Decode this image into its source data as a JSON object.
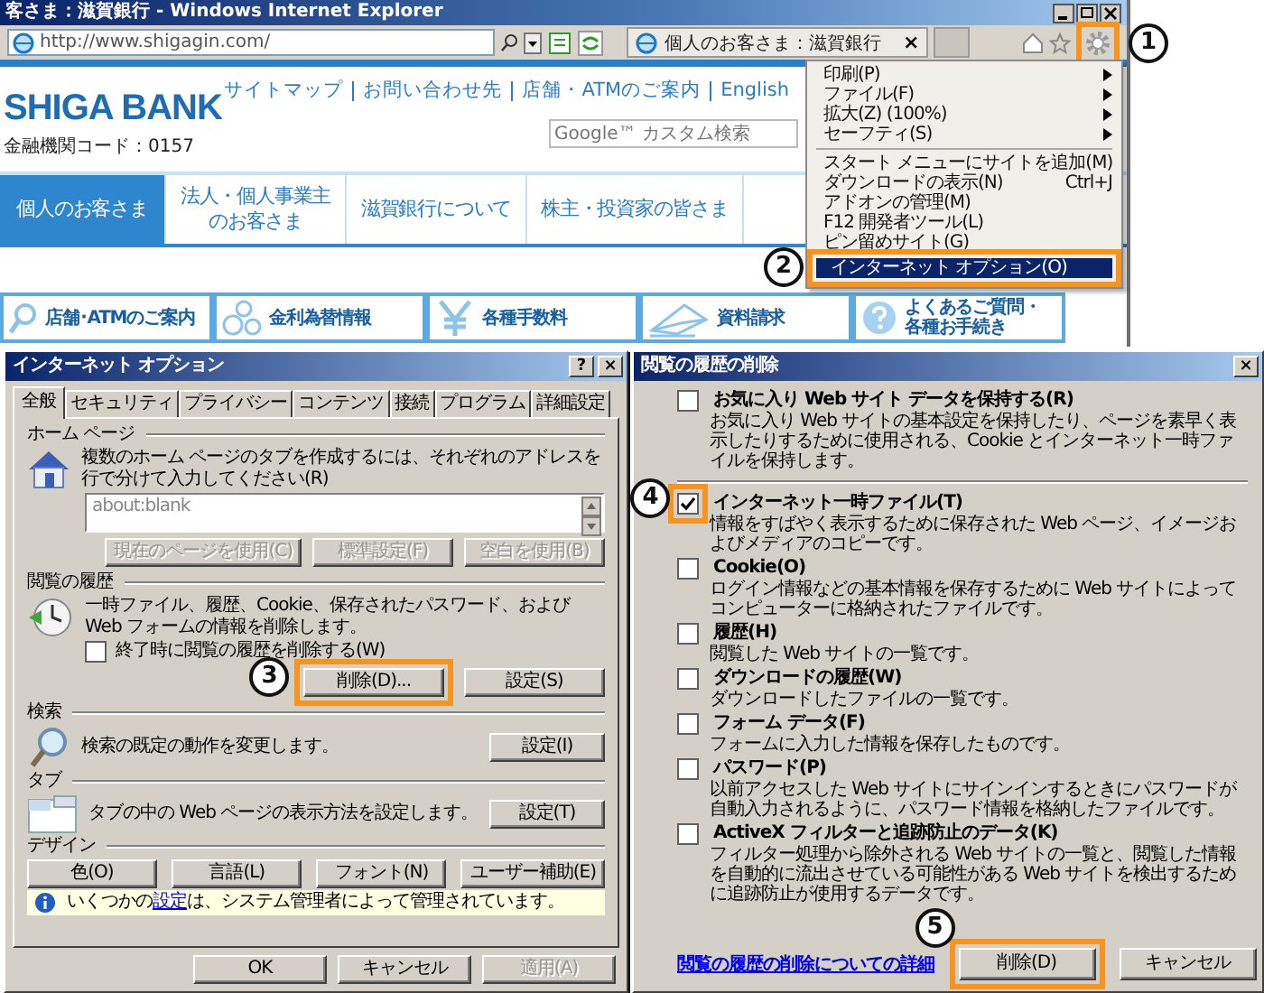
{
  "browser": {
    "title": "客さま：滋賀銀行 - Windows Internet Explorer",
    "address": "http://www.shigagin.com/",
    "tab": {
      "title": "個人のお客さま：滋賀銀行",
      "close": "×"
    },
    "settings": {
      "highlighted": true,
      "callout": "1"
    }
  },
  "page": {
    "logo": "SHIGA BANK",
    "bank_code": "金融機関コード：0157",
    "top_links": [
      "サイトマップ",
      "お問い合わせ先",
      "店舗・ATMのご案内",
      "English"
    ],
    "search_placeholder": "Google™ カスタム検索",
    "nav": [
      {
        "label": "個人のお客さま",
        "selected": true
      },
      {
        "label": "法人・個人事業主のお客さま",
        "selected": false
      },
      {
        "label": "滋賀銀行について",
        "selected": false
      },
      {
        "label": "株主・投資家の皆さま",
        "selected": false
      }
    ],
    "quick_links": [
      {
        "label": "店舗･ATMのご案内",
        "kind": "store_search"
      },
      {
        "label": "金利為替情報",
        "kind": "rates"
      },
      {
        "label": "各種手数料",
        "kind": "fees"
      },
      {
        "label": "資料請求",
        "kind": "request"
      },
      {
        "label": "よくあるご質問・各種お手続き",
        "kind": "faq"
      }
    ]
  },
  "tools_menu": {
    "items": [
      {
        "kind": "item",
        "label": "印刷(P)",
        "submenu": true,
        "selected": false,
        "highlighted": false
      },
      {
        "kind": "item",
        "label": "ファイル(F)",
        "submenu": true,
        "selected": false,
        "highlighted": false
      },
      {
        "kind": "item",
        "label": "拡大(Z) (100%)",
        "submenu": true,
        "selected": false,
        "highlighted": false
      },
      {
        "kind": "item",
        "label": "セーフティ(S)",
        "submenu": true,
        "selected": false,
        "highlighted": false
      },
      {
        "kind": "separator"
      },
      {
        "kind": "item",
        "label": "スタート メニューにサイトを追加(M)",
        "submenu": false,
        "selected": false,
        "highlighted": false
      },
      {
        "kind": "item",
        "label": "ダウンロードの表示(N)",
        "shortcut": "Ctrl+J",
        "submenu": false,
        "selected": false,
        "highlighted": false
      },
      {
        "kind": "item",
        "label": "アドオンの管理(M)",
        "submenu": false,
        "selected": false,
        "highlighted": false
      },
      {
        "kind": "item",
        "label": "F12 開発者ツール(L)",
        "submenu": false,
        "selected": false,
        "highlighted": false
      },
      {
        "kind": "item",
        "label": "ピン留めサイト(G)",
        "submenu": false,
        "selected": false,
        "highlighted": false
      },
      {
        "kind": "item",
        "label": "インターネット オプション(O)",
        "submenu": false,
        "selected": true,
        "highlighted": true,
        "callout": "2"
      }
    ]
  },
  "internet_options": {
    "title": "インターネット オプション",
    "help": "?",
    "close": "×",
    "tabs": [
      {
        "label": "全般",
        "selected": true
      },
      {
        "label": "セキュリティ",
        "selected": false
      },
      {
        "label": "プライバシー",
        "selected": false
      },
      {
        "label": "コンテンツ",
        "selected": false
      },
      {
        "label": "接続",
        "selected": false
      },
      {
        "label": "プログラム",
        "selected": false
      },
      {
        "label": "詳細設定",
        "selected": false
      }
    ],
    "sections": [
      {
        "kind": "home_page",
        "heading": "ホーム ページ",
        "text": "複数のホーム ページのタブを作成するには、それぞれのアドレスを行で分けて入力してください(R)",
        "value": "about:blank",
        "buttons": [
          {
            "label": "現在のページを使用(C)",
            "disabled": true,
            "highlighted": false
          },
          {
            "label": "標準設定(F)",
            "disabled": true,
            "highlighted": false
          },
          {
            "label": "空白を使用(B)",
            "disabled": true,
            "highlighted": false
          }
        ]
      },
      {
        "kind": "history",
        "heading": "閲覧の履歴",
        "text": "一時ファイル、履歴、Cookie、保存されたパスワード、および Web フォームの情報を削除します。",
        "checkbox": {
          "label": "終了時に閲覧の履歴を削除する(W)",
          "checked": false
        },
        "buttons": [
          {
            "label": "削除(D)...",
            "disabled": false,
            "highlighted": true,
            "callout": "3"
          },
          {
            "label": "設定(S)",
            "disabled": false,
            "highlighted": false
          }
        ]
      },
      {
        "kind": "search",
        "heading": "検索",
        "text": "検索の既定の動作を変更します。",
        "buttons": [
          {
            "label": "設定(I)",
            "disabled": false,
            "highlighted": false
          }
        ]
      },
      {
        "kind": "tabs",
        "heading": "タブ",
        "text": "タブの中の Web ページの表示方法を設定します。",
        "buttons": [
          {
            "label": "設定(T)",
            "disabled": false,
            "highlighted": false
          }
        ]
      },
      {
        "kind": "design",
        "heading": "デザイン",
        "buttons": [
          {
            "label": "色(O)",
            "disabled": false,
            "highlighted": false
          },
          {
            "label": "言語(L)",
            "disabled": false,
            "highlighted": false
          },
          {
            "label": "フォント(N)",
            "disabled": false,
            "highlighted": false
          },
          {
            "label": "ユーザー補助(E)",
            "disabled": false,
            "highlighted": false
          }
        ]
      }
    ],
    "info": {
      "before": "いくつかの",
      "link": "設定",
      "after": "は、システム管理者によって管理されています。"
    },
    "buttons": [
      {
        "label": "OK",
        "disabled": false,
        "highlighted": false
      },
      {
        "label": "キャンセル",
        "disabled": false,
        "highlighted": false
      },
      {
        "label": "適用(A)",
        "disabled": true,
        "highlighted": false
      }
    ]
  },
  "delete_history": {
    "title": "閲覧の履歴の削除",
    "close": "×",
    "options": [
      {
        "label": "お気に入り Web サイト データを保持する(R)",
        "description": "お気に入り Web サイトの基本設定を保持したり、ページを素早く表示したりするために使用される、Cookie とインターネット一時ファイルを保持します。",
        "checked": false,
        "highlighted": false,
        "divider_after": true
      },
      {
        "label": "インターネット一時ファイル(T)",
        "description": "情報をすばやく表示するために保存された Web ページ、イメージおよびメディアのコピーです。",
        "checked": true,
        "highlighted": true,
        "callout": "4",
        "divider_after": false
      },
      {
        "label": "Cookie(O)",
        "description": "ログイン情報などの基本情報を保存するために Web サイトによってコンピューターに格納されたファイルです。",
        "checked": false,
        "highlighted": false,
        "divider_after": false
      },
      {
        "label": "履歴(H)",
        "description": "閲覧した Web サイトの一覧です。",
        "checked": false,
        "highlighted": false,
        "divider_after": false
      },
      {
        "label": "ダウンロードの履歴(W)",
        "description": "ダウンロードしたファイルの一覧です。",
        "checked": false,
        "highlighted": false,
        "divider_after": false
      },
      {
        "label": "フォーム データ(F)",
        "description": "フォームに入力した情報を保存したものです。",
        "checked": false,
        "highlighted": false,
        "divider_after": false
      },
      {
        "label": "パスワード(P)",
        "description": "以前アクセスした Web サイトにサインインするときにパスワードが自動入力されるように、パスワード情報を格納したファイルです。",
        "checked": false,
        "highlighted": false,
        "divider_after": false
      },
      {
        "label": "ActiveX フィルターと追跡防止のデータ(K)",
        "description": "フィルター処理から除外される Web サイトの一覧と、閲覧した情報を自動的に流出させている可能性がある Web サイトを検出するために追跡防止が使用するデータです。",
        "checked": false,
        "highlighted": false,
        "divider_after": false
      }
    ],
    "link": "閲覧の履歴の削除についての詳細",
    "buttons": [
      {
        "label": "削除(D)",
        "disabled": false,
        "highlighted": true,
        "callout": "5"
      },
      {
        "label": "キャンセル",
        "disabled": false,
        "highlighted": false
      }
    ]
  }
}
